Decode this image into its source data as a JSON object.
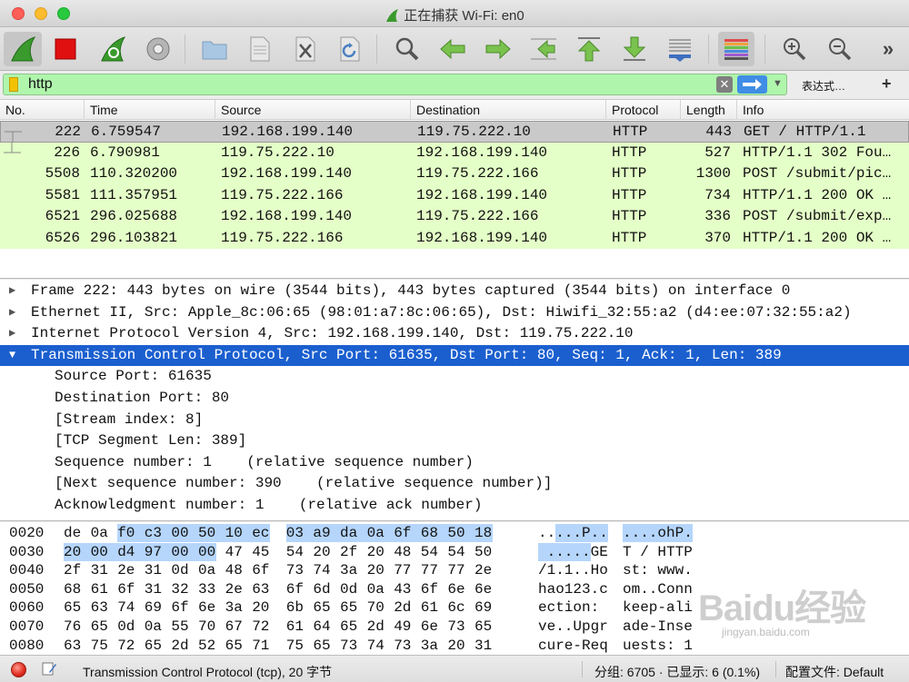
{
  "window": {
    "title": "正在捕获 Wi-Fi: en0"
  },
  "toolbar": {
    "buttons": [
      "shark-fin-start-icon",
      "stop-capture-icon",
      "restart-capture-icon",
      "capture-options-icon",
      "open-file-icon",
      "save-file-icon",
      "close-file-icon",
      "reload-file-icon",
      "find-packet-icon",
      "go-back-icon",
      "go-forward-icon",
      "go-to-packet-icon",
      "go-first-icon",
      "go-last-icon",
      "autoscroll-icon",
      "colorize-icon",
      "zoom-in-icon",
      "zoom-out-icon",
      "more-icon"
    ]
  },
  "filter": {
    "value": "http",
    "clear_symbol": "✕",
    "expression_label": "表达式…",
    "add_symbol": "+"
  },
  "packet_list": {
    "columns": [
      "No.",
      "Time",
      "Source",
      "Destination",
      "Protocol",
      "Length",
      "Info"
    ],
    "rows": [
      {
        "no": "222",
        "time": "6.759547",
        "src": "192.168.199.140",
        "dst": "119.75.222.10",
        "proto": "HTTP",
        "len": "443",
        "info": "GET / HTTP/1.1"
      },
      {
        "no": "226",
        "time": "6.790981",
        "src": "119.75.222.10",
        "dst": "192.168.199.140",
        "proto": "HTTP",
        "len": "527",
        "info": "HTTP/1.1 302 Fou…"
      },
      {
        "no": "5508",
        "time": "110.320200",
        "src": "192.168.199.140",
        "dst": "119.75.222.166",
        "proto": "HTTP",
        "len": "1300",
        "info": "POST /submit/pic…"
      },
      {
        "no": "5581",
        "time": "111.357951",
        "src": "119.75.222.166",
        "dst": "192.168.199.140",
        "proto": "HTTP",
        "len": "734",
        "info": "HTTP/1.1 200 OK …"
      },
      {
        "no": "6521",
        "time": "296.025688",
        "src": "192.168.199.140",
        "dst": "119.75.222.166",
        "proto": "HTTP",
        "len": "336",
        "info": "POST /submit/exp…"
      },
      {
        "no": "6526",
        "time": "296.103821",
        "src": "119.75.222.166",
        "dst": "192.168.199.140",
        "proto": "HTTP",
        "len": "370",
        "info": "HTTP/1.1 200 OK …"
      }
    ]
  },
  "details": {
    "rows": [
      {
        "text": "Frame 222: 443 bytes on wire (3544 bits), 443 bytes captured (3544 bits) on interface 0",
        "state": "collapsed"
      },
      {
        "text": "Ethernet II, Src: Apple_8c:06:65 (98:01:a7:8c:06:65), Dst: Hiwifi_32:55:a2 (d4:ee:07:32:55:a2)",
        "state": "collapsed"
      },
      {
        "text": "Internet Protocol Version 4, Src: 192.168.199.140, Dst: 119.75.222.10",
        "state": "collapsed"
      },
      {
        "text": "Transmission Control Protocol, Src Port: 61635, Dst Port: 80, Seq: 1, Ack: 1, Len: 389",
        "state": "expanded"
      },
      {
        "text": "Source Port: 61635",
        "state": "child"
      },
      {
        "text": "Destination Port: 80",
        "state": "child"
      },
      {
        "text": "[Stream index: 8]",
        "state": "child"
      },
      {
        "text": "[TCP Segment Len: 389]",
        "state": "child"
      },
      {
        "text": "Sequence number: 1    (relative sequence number)",
        "state": "child"
      },
      {
        "text": "[Next sequence number: 390    (relative sequence number)]",
        "state": "child"
      },
      {
        "text": "Acknowledgment number: 1    (relative ack number)",
        "state": "child"
      }
    ]
  },
  "hex": {
    "rows": [
      {
        "offset": "0020",
        "bytes": [
          "de",
          "0a",
          "f0",
          "c3",
          "00",
          "50",
          "10",
          "ec",
          "03",
          "a9",
          "da",
          "0a",
          "6f",
          "68",
          "50",
          "18"
        ],
        "ascii1": "..",
        "ascii1b": "...P..",
        "ascii2": "....ohP."
      },
      {
        "offset": "0030",
        "bytes": [
          "20",
          "00",
          "d4",
          "97",
          "00",
          "00",
          "47",
          "45",
          "54",
          "20",
          "2f",
          "20",
          "48",
          "54",
          "54",
          "50"
        ],
        "ascii1": " .....",
        "ascii1b": "GE",
        "ascii2": "T / HTTP"
      },
      {
        "offset": "0040",
        "bytes": [
          "2f",
          "31",
          "2e",
          "31",
          "0d",
          "0a",
          "48",
          "6f",
          "73",
          "74",
          "3a",
          "20",
          "77",
          "77",
          "77",
          "2e"
        ],
        "ascii1": "/1.1..Ho",
        "ascii1b": "",
        "ascii2": "st: www."
      },
      {
        "offset": "0050",
        "bytes": [
          "68",
          "61",
          "6f",
          "31",
          "32",
          "33",
          "2e",
          "63",
          "6f",
          "6d",
          "0d",
          "0a",
          "43",
          "6f",
          "6e",
          "6e"
        ],
        "ascii1": "hao123.c",
        "ascii1b": "",
        "ascii2": "om..Conn"
      },
      {
        "offset": "0060",
        "bytes": [
          "65",
          "63",
          "74",
          "69",
          "6f",
          "6e",
          "3a",
          "20",
          "6b",
          "65",
          "65",
          "70",
          "2d",
          "61",
          "6c",
          "69"
        ],
        "ascii1": "ection: ",
        "ascii1b": "",
        "ascii2": "keep-ali"
      },
      {
        "offset": "0070",
        "bytes": [
          "76",
          "65",
          "0d",
          "0a",
          "55",
          "70",
          "67",
          "72",
          "61",
          "64",
          "65",
          "2d",
          "49",
          "6e",
          "73",
          "65"
        ],
        "ascii1": "ve..Upgr",
        "ascii1b": "",
        "ascii2": "ade-Inse"
      },
      {
        "offset": "0080",
        "bytes": [
          "63",
          "75",
          "72",
          "65",
          "2d",
          "52",
          "65",
          "71",
          "75",
          "65",
          "73",
          "74",
          "73",
          "3a",
          "20",
          "31"
        ],
        "ascii1": "cure-Req",
        "ascii1b": "",
        "ascii2": "uests: 1"
      }
    ]
  },
  "status": {
    "field_info": "Transmission Control Protocol (tcp), 20 字节",
    "packets": "分组: 6705 · 已显示: 6 (0.1%)",
    "profile": "配置文件: Default"
  },
  "watermark": {
    "logo": "Baidu经验",
    "url": "jingyan.baidu.com"
  },
  "colors": {
    "http_row": "#e4ffc7",
    "selected_row": "#c9c9c9",
    "tree_selected": "#1b5fcf",
    "hex_highlight": "#b5d5fb",
    "filter_valid": "#aff5ac"
  }
}
